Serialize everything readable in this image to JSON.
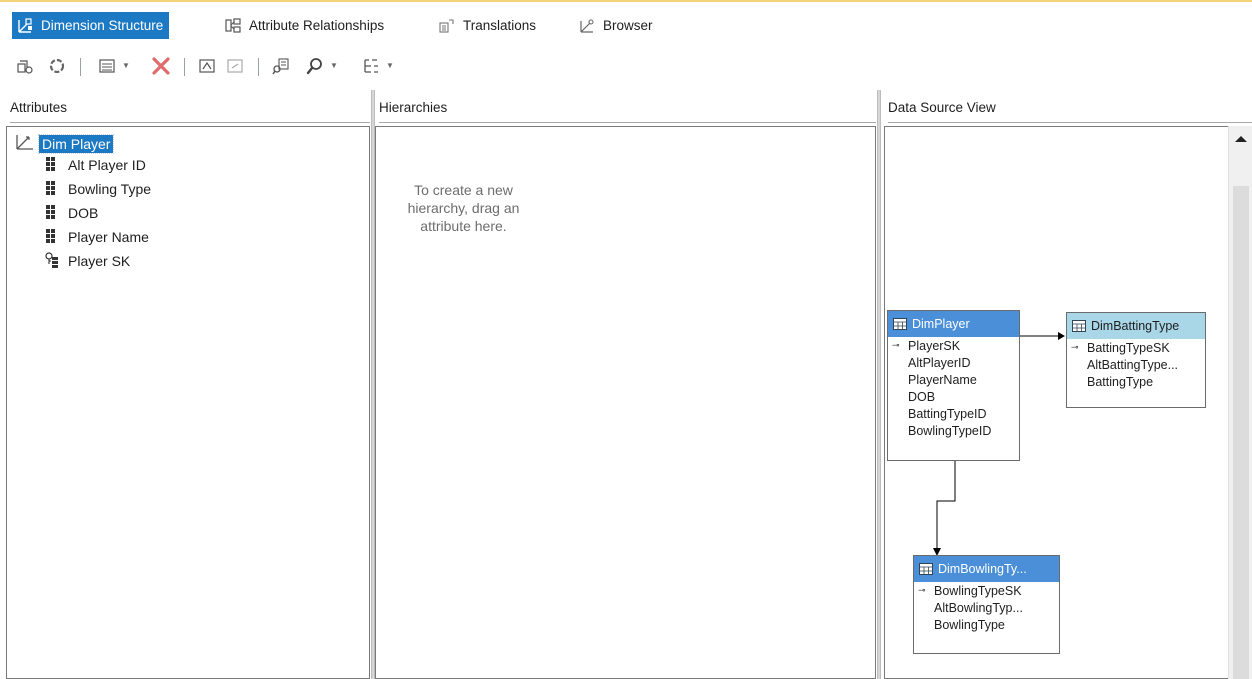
{
  "tabs": [
    {
      "label": "Dimension Structure",
      "icon": "dimension-structure-icon",
      "active": true
    },
    {
      "label": "Attribute Relationships",
      "icon": "attribute-relationships-icon",
      "active": false
    },
    {
      "label": "Translations",
      "icon": "translations-icon",
      "active": false
    },
    {
      "label": "Browser",
      "icon": "browser-icon",
      "active": false
    }
  ],
  "toolbar": {
    "icons": [
      "auto-build-icon",
      "refresh-icon",
      "show-list-icon",
      "delete-icon",
      "attribute-icon",
      "table-icon",
      "explore-data-icon",
      "zoom-icon",
      "layout-icon"
    ]
  },
  "panes": {
    "attributes": {
      "header": "Attributes",
      "root": "Dim Player",
      "items": [
        "Alt Player ID",
        "Bowling Type",
        "DOB",
        "Player Name",
        "Player SK"
      ]
    },
    "hierarchies": {
      "header": "Hierarchies",
      "hint": [
        "To create a new",
        "hierarchy, drag an",
        "attribute here."
      ]
    },
    "dsv": {
      "header": "Data Source View",
      "tables": {
        "player": {
          "title": "DimPlayer",
          "key": "PlayerSK",
          "columns": [
            "AltPlayerID",
            "PlayerName",
            "DOB",
            "BattingTypeID",
            "BowlingTypeID"
          ]
        },
        "batting": {
          "title": "DimBattingType",
          "key": "BattingTypeSK",
          "columns": [
            "AltBattingType...",
            "BattingType"
          ]
        },
        "bowling": {
          "title": "DimBowlingTy...",
          "key": "BowlingTypeSK",
          "columns": [
            "AltBowlingTyp...",
            "BowlingType"
          ]
        }
      }
    }
  },
  "colors": {
    "accent": "#1c79c4",
    "selected_table": "#4a8fd8",
    "unselected_table": "#a9d7e8"
  }
}
